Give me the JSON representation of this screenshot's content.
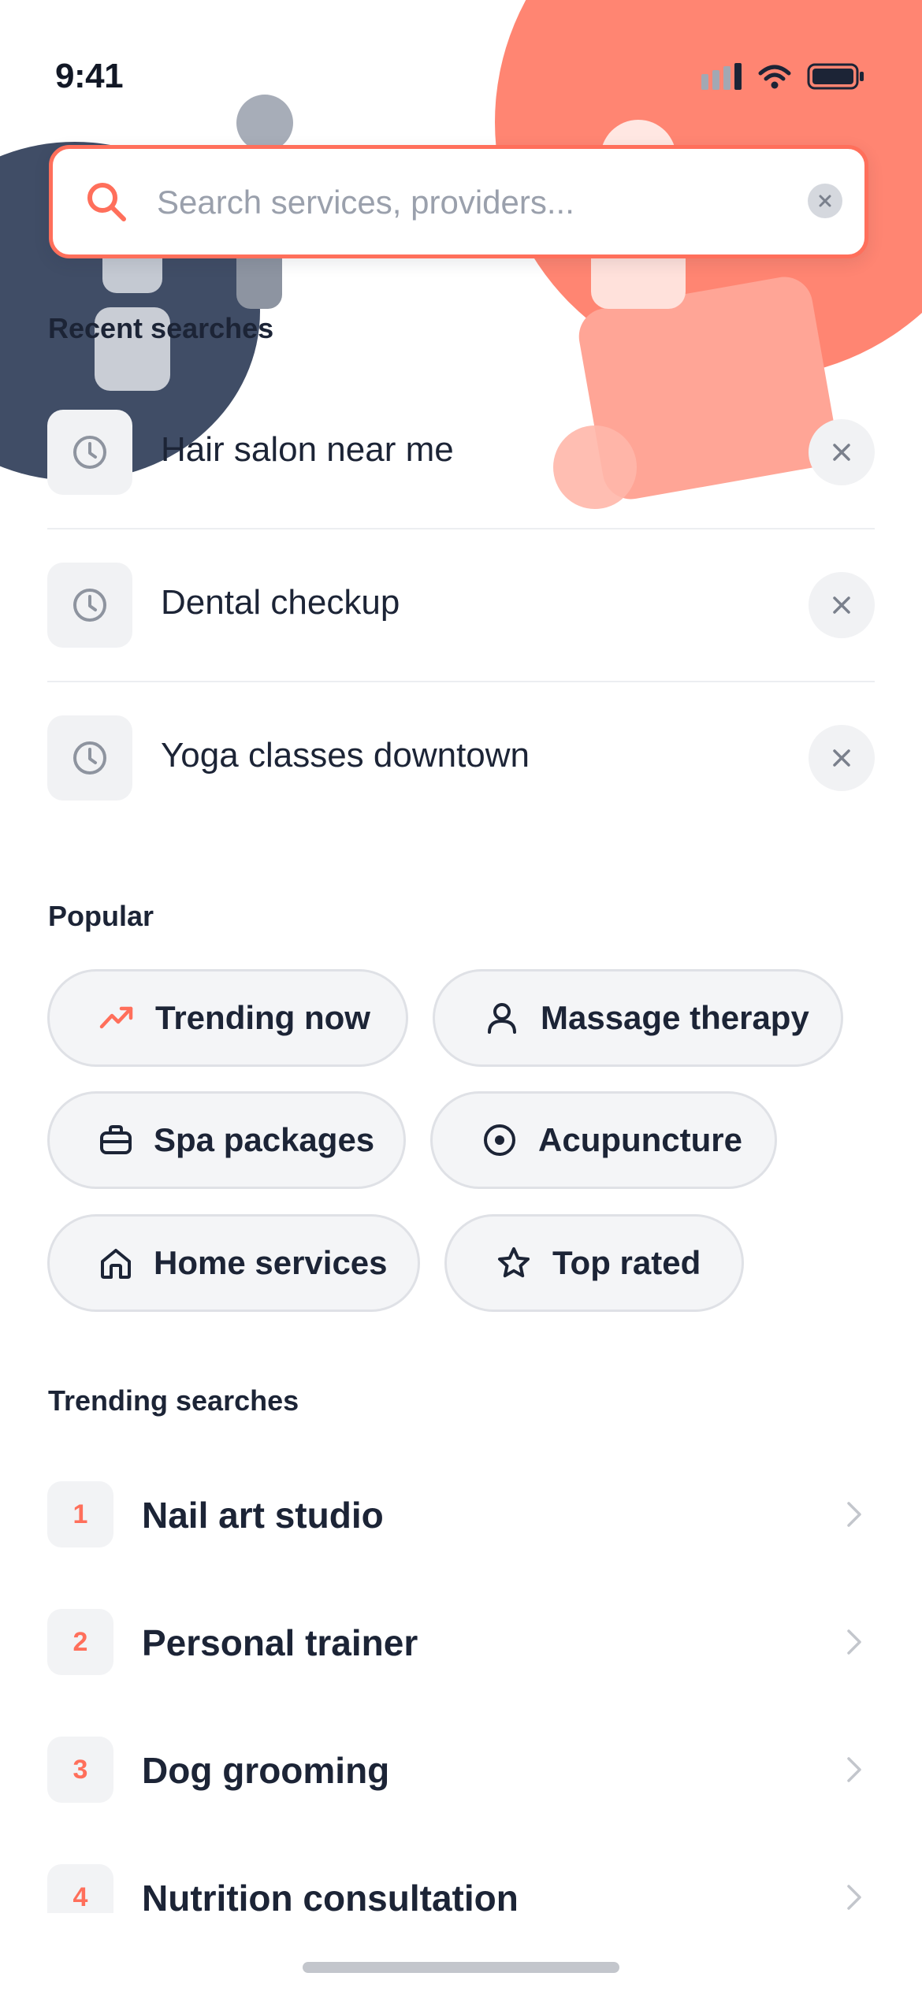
{
  "status_bar": {
    "time": "9:41"
  },
  "search": {
    "placeholder": "Search services, providers..."
  },
  "recent": {
    "title": "Recent searches",
    "items": [
      {
        "label": "Hair salon near me"
      },
      {
        "label": "Dental checkup"
      },
      {
        "label": "Yoga classes downtown"
      }
    ]
  },
  "popular": {
    "title": "Popular",
    "chips": [
      {
        "label": "Trending now",
        "icon": "trending-up-icon"
      },
      {
        "label": "Massage therapy",
        "icon": "person-icon"
      },
      {
        "label": "Spa packages",
        "icon": "briefcase-icon"
      },
      {
        "label": "Acupuncture",
        "icon": "target-icon"
      },
      {
        "label": "Home services",
        "icon": "home-icon"
      },
      {
        "label": "Top rated",
        "icon": "star-icon"
      }
    ]
  },
  "trending": {
    "title": "Trending searches",
    "items": [
      {
        "rank": "1",
        "label": "Nail art studio"
      },
      {
        "rank": "2",
        "label": "Personal trainer"
      },
      {
        "rank": "3",
        "label": "Dog grooming"
      },
      {
        "rank": "4",
        "label": "Nutrition consultation"
      }
    ]
  },
  "colors": {
    "accent": "#ff6f5b",
    "text": "#1c2436",
    "muted": "#9aa0ac",
    "chip_bg": "#f4f5f7"
  }
}
